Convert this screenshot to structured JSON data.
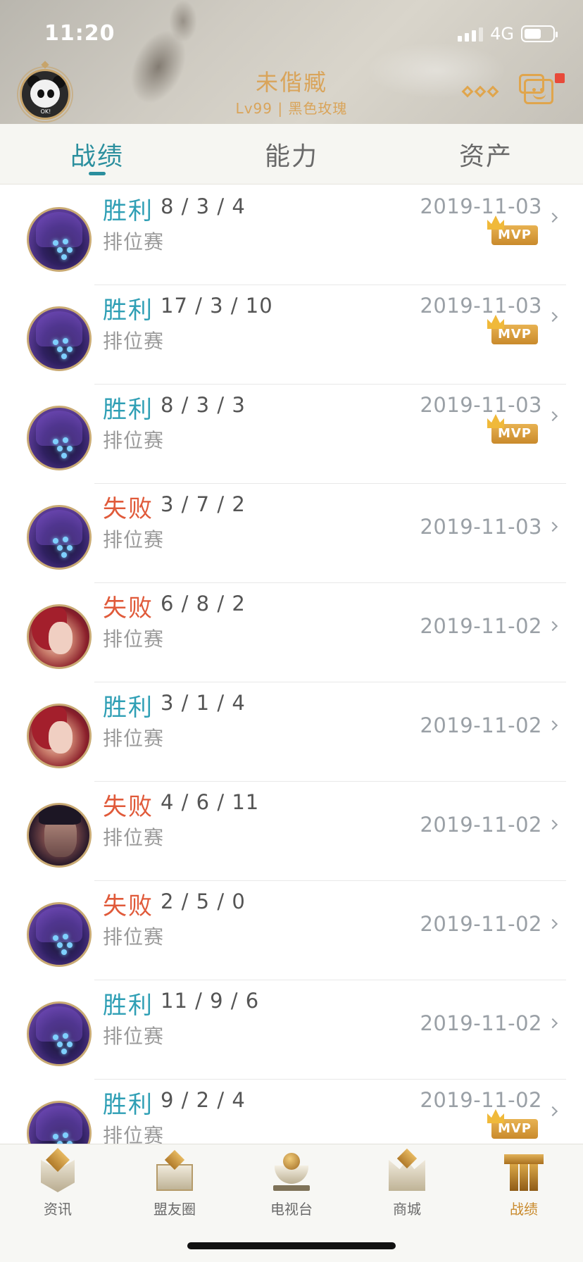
{
  "status_bar": {
    "time": "11:20",
    "network": "4G"
  },
  "profile": {
    "avatar_tag": "OK!",
    "name": "未偕臧",
    "level_line": "Lv99 | 黑色玫瑰"
  },
  "tabs": [
    {
      "label": "战绩",
      "active": true
    },
    {
      "label": "能力",
      "active": false
    },
    {
      "label": "资产",
      "active": false
    }
  ],
  "matches": [
    {
      "result": "胜利",
      "outcome": "win",
      "kda": "8 / 3 / 4",
      "mode": "排位赛",
      "date": "2019-11-03",
      "mvp": true,
      "mvp_label": "MVP",
      "hero": "purple"
    },
    {
      "result": "胜利",
      "outcome": "win",
      "kda": "17 / 3 / 10",
      "mode": "排位赛",
      "date": "2019-11-03",
      "mvp": true,
      "mvp_label": "MVP",
      "hero": "purple"
    },
    {
      "result": "胜利",
      "outcome": "win",
      "kda": "8 / 3 / 3",
      "mode": "排位赛",
      "date": "2019-11-03",
      "mvp": true,
      "mvp_label": "MVP",
      "hero": "purple"
    },
    {
      "result": "失败",
      "outcome": "loss",
      "kda": "3 / 7 / 2",
      "mode": "排位赛",
      "date": "2019-11-03",
      "mvp": false,
      "hero": "purple"
    },
    {
      "result": "失败",
      "outcome": "loss",
      "kda": "6 / 8 / 2",
      "mode": "排位赛",
      "date": "2019-11-02",
      "mvp": false,
      "hero": "red"
    },
    {
      "result": "胜利",
      "outcome": "win",
      "kda": "3 / 1 / 4",
      "mode": "排位赛",
      "date": "2019-11-02",
      "mvp": false,
      "hero": "red"
    },
    {
      "result": "失败",
      "outcome": "loss",
      "kda": "4 / 6 / 11",
      "mode": "排位赛",
      "date": "2019-11-02",
      "mvp": false,
      "hero": "dark"
    },
    {
      "result": "失败",
      "outcome": "loss",
      "kda": "2 / 5 / 0",
      "mode": "排位赛",
      "date": "2019-11-02",
      "mvp": false,
      "hero": "purple"
    },
    {
      "result": "胜利",
      "outcome": "win",
      "kda": "11 / 9 / 6",
      "mode": "排位赛",
      "date": "2019-11-02",
      "mvp": false,
      "hero": "purple"
    },
    {
      "result": "胜利",
      "outcome": "win",
      "kda": "9 / 2 / 4",
      "mode": "排位赛",
      "date": "2019-11-02",
      "mvp": true,
      "mvp_label": "MVP",
      "hero": "purple"
    }
  ],
  "bottom_nav": [
    {
      "label": "资讯",
      "icon": "news-icon",
      "active": false
    },
    {
      "label": "盟友圈",
      "icon": "friends-icon",
      "active": false
    },
    {
      "label": "电视台",
      "icon": "tv-icon",
      "active": false
    },
    {
      "label": "商城",
      "icon": "shop-icon",
      "active": false
    },
    {
      "label": "战绩",
      "icon": "record-icon",
      "active": true
    }
  ],
  "colors": {
    "accent_teal": "#2b8f9e",
    "win": "#2f9fb5",
    "loss": "#e05a3a",
    "gold": "#d9a45a",
    "mvp": "#d49a3a"
  }
}
